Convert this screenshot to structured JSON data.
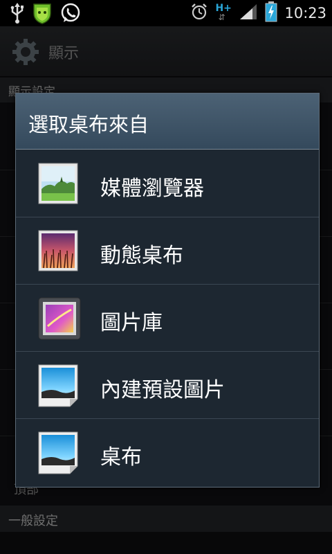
{
  "status_bar": {
    "time": "10:23",
    "network_type": "H+",
    "icons": [
      "usb-icon",
      "android-security-icon",
      "whatsapp-icon",
      "alarm-icon",
      "signal-icon",
      "battery-charging-icon"
    ]
  },
  "action_bar": {
    "title": "顯示",
    "icon": "settings-gear-icon"
  },
  "background": {
    "section_header": "顯示設定",
    "partial_item": "頂部",
    "section_header_2": "一般設定"
  },
  "dialog": {
    "title": "選取桌布來自",
    "items": [
      {
        "label": "媒體瀏覽器",
        "icon": "media-browser-icon"
      },
      {
        "label": "動態桌布",
        "icon": "live-wallpaper-icon"
      },
      {
        "label": "圖片庫",
        "icon": "gallery-icon"
      },
      {
        "label": "內建預設圖片",
        "icon": "preset-image-icon"
      },
      {
        "label": "桌布",
        "icon": "wallpaper-icon"
      }
    ]
  },
  "colors": {
    "dialog_bg": "#1d2731",
    "dialog_title_bg": "#4c6275",
    "accent_status": "#2aa6d8"
  }
}
